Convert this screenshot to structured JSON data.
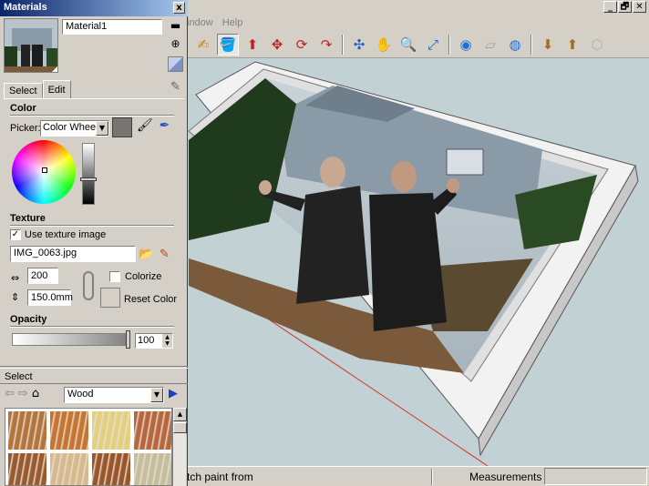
{
  "app": {
    "menu": [
      "indow",
      "Help"
    ],
    "window_buttons": [
      "_",
      "🗗",
      "✕"
    ],
    "toolbar": [
      {
        "icon": "orbit-icon"
      },
      {
        "icon": "paint-bucket-icon"
      },
      {
        "icon": "push-pull-icon"
      },
      {
        "icon": "move-icon"
      },
      {
        "icon": "rotate-icon"
      },
      {
        "icon": "follow-me-icon"
      },
      {
        "icon": "orbit-view-icon"
      },
      {
        "icon": "pan-icon"
      },
      {
        "icon": "zoom-icon"
      },
      {
        "icon": "zoom-extents-icon"
      },
      {
        "icon": "3d-warehouse-icon"
      },
      {
        "icon": "share-model-icon"
      },
      {
        "icon": "google-earth-icon"
      },
      {
        "icon": "get-models-icon"
      },
      {
        "icon": "share-component-icon"
      },
      {
        "icon": "extension-icon"
      }
    ],
    "status_text": "tch paint from",
    "measurements_label": "Measurements",
    "measurements_value": ""
  },
  "materials": {
    "title": "Materials",
    "close": "x",
    "material_name": "Material1",
    "tabs": [
      {
        "label": "Select"
      },
      {
        "label": "Edit",
        "active": true
      }
    ],
    "color": {
      "section_title": "Color",
      "picker_label": "Picker:",
      "picker_value": "Color Wheel",
      "current_color": "#777570"
    },
    "texture": {
      "section_title": "Texture",
      "use_texture_label": "Use texture image",
      "use_texture_checked": true,
      "file_name": "IMG_0063.jpg",
      "width": "200",
      "height": "150.0mm",
      "colorize_label": "Colorize",
      "colorize_checked": false,
      "reset_color_label": "Reset Color"
    },
    "opacity": {
      "section_title": "Opacity",
      "value": "100"
    },
    "select": {
      "label": "Select",
      "library": "Wood",
      "swatches": [
        {
          "color": "#b5743a"
        },
        {
          "color": "#c8742e"
        },
        {
          "color": "#e5cf7a"
        },
        {
          "color": "#b8663a"
        },
        {
          "color": "#9a5a2a"
        },
        {
          "color": "#d9b88a"
        },
        {
          "color": "#9b5526"
        },
        {
          "color": "#c7bd98"
        }
      ]
    }
  }
}
